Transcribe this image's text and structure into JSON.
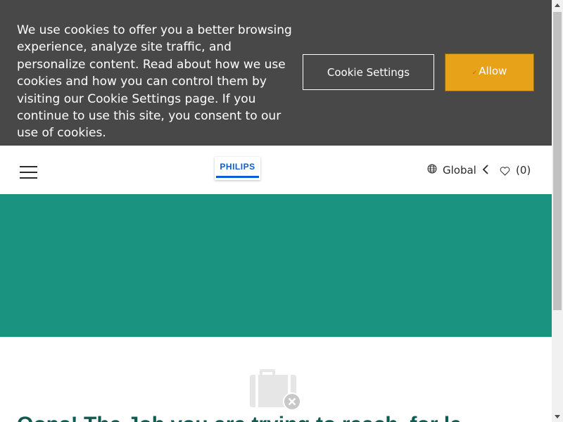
{
  "cookie_banner": {
    "message": "We use cookies to offer you a better browsing experience, analyze site traffic, and personalize content. Read about how we use cookies and how you can control them by visiting our Cookie Settings page. If you continue to use this site, you consent to our use of cookies.",
    "settings_label": "Cookie Settings",
    "allow_label": "Allow",
    "allow_icon": "check-icon",
    "colors": {
      "background": "#484848",
      "allow_button": "#e8a219"
    }
  },
  "header": {
    "menu_icon": "hamburger-menu-icon",
    "logo_text": "PHILIPS",
    "region_icon": "globe-icon",
    "region_label": "Global",
    "back_icon": "chevron-left-icon",
    "wishlist_icon": "heart-icon",
    "wishlist_count": "(0)"
  },
  "hero": {
    "color": "#1a9480"
  },
  "content": {
    "empty_icon": "shopping-bag-remove-icon",
    "heading": "Oops! The Job you are trying to reach, for le"
  }
}
